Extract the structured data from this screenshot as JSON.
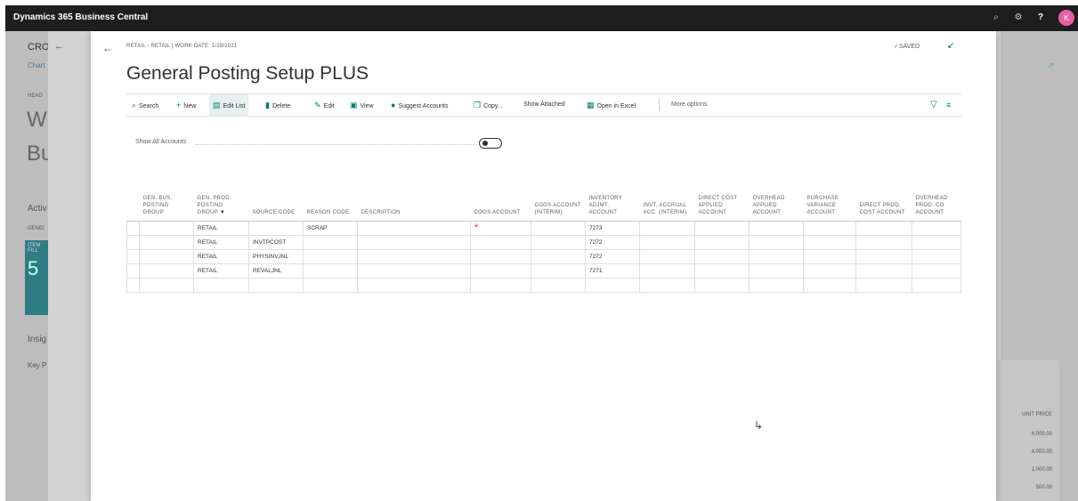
{
  "app": {
    "title": "Dynamics 365 Business Central",
    "avatar_initial": "K",
    "icons": [
      "search-icon",
      "settings-icon",
      "help-icon"
    ]
  },
  "background": {
    "company_abbrev": "CRO",
    "chart_link": "Chart",
    "head_label": "HEAD",
    "big_letter_1": "W",
    "big_letter_2": "Bu",
    "activities": "Activ",
    "general": "GENEI",
    "tile_line1": "ITEM",
    "tile_line2": "FILL",
    "tile_value": "5",
    "insights": "Insig",
    "key_perf": "Key P",
    "unit_price_header": "UNIT PRICE",
    "unit_prices": [
      "4,000.00",
      "4,000.00",
      "1,000.00",
      "500.00"
    ]
  },
  "dialog": {
    "breadcrumb": "RETAIL - RETAIL | WORK DATE: 1/28/2021",
    "saved_label": "✓SAVED",
    "title": "General Posting Setup PLUS",
    "actions": {
      "search": "Search",
      "new": "New",
      "edit_list": "Edit List",
      "delete": "Delete",
      "edit": "Edit",
      "view": "View",
      "suggest_accounts": "Suggest Accounts",
      "copy": "Copy...",
      "show_attached": "Show Attached",
      "open_in_excel": "Open in Excel",
      "more_options": "More options"
    },
    "toggle": {
      "label": "Show All Accounts",
      "value": "off"
    },
    "table": {
      "columns": [
        "GEN. BUS. POSTING GROUP",
        "GEN. PROD. POSTING GROUP",
        "SOURCE CODE",
        "REASON CODE",
        "DESCRIPTION",
        "COGS ACCOUNT",
        "COGS ACCOUNT (INTERIM)",
        "INVENTORY ADJMT. ACCOUNT",
        "INVT. ACCRUAL ACC. (INTERIM)",
        "DIRECT COST APPLIED ACCOUNT",
        "OVERHEAD APPLIED ACCOUNT",
        "PURCHASE VARIANCE ACCOUNT",
        "DIRECT PROD. COST ACCOUNT",
        "OVERHEAD PROD. CO ACCOUNT"
      ],
      "rows": [
        {
          "bus": "",
          "prod": "RETAIL",
          "source": "",
          "reason": "SCRAP",
          "desc": "",
          "cogs": "*",
          "cogs_int": "",
          "inv_adj": "7273"
        },
        {
          "bus": "",
          "prod": "RETAIL",
          "source": "INVTPCOST",
          "reason": "",
          "desc": "",
          "cogs": "",
          "cogs_int": "",
          "inv_adj": "7272"
        },
        {
          "bus": "",
          "prod": "RETAIL",
          "source": "PHYSINVJNL",
          "reason": "",
          "desc": "",
          "cogs": "",
          "cogs_int": "",
          "inv_adj": "7272"
        },
        {
          "bus": "",
          "prod": "RETAIL",
          "source": "REVALJNL",
          "reason": "",
          "desc": "",
          "cogs": "",
          "cogs_int": "",
          "inv_adj": "7271"
        },
        {
          "bus": "",
          "prod": "",
          "source": "",
          "reason": "",
          "desc": "",
          "cogs": "",
          "cogs_int": "",
          "inv_adj": ""
        }
      ]
    }
  }
}
